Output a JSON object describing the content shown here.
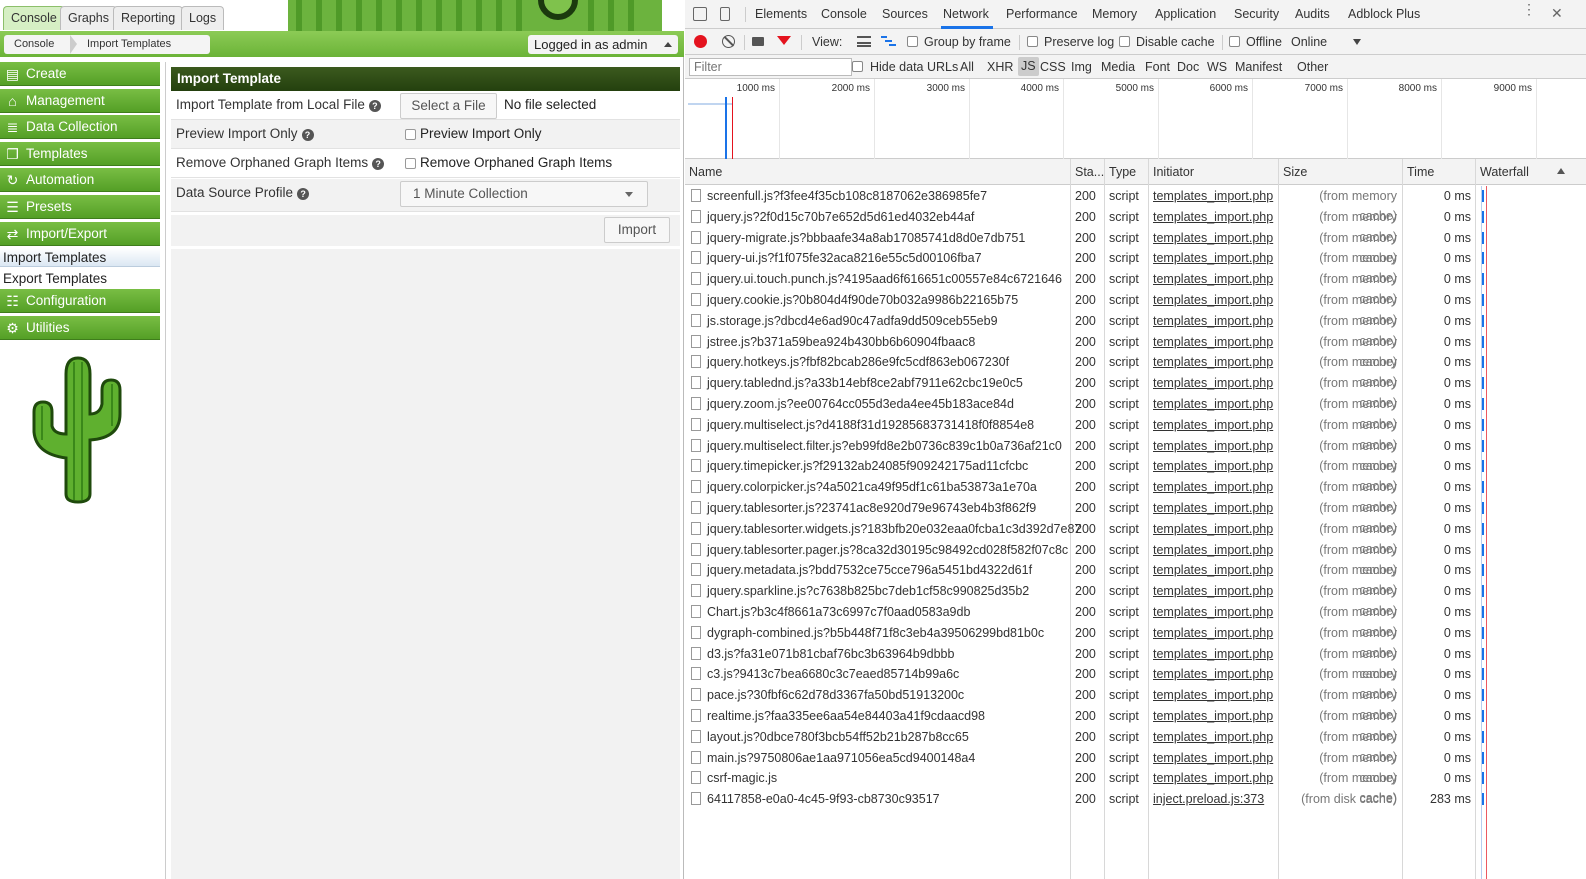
{
  "cacti": {
    "top_tabs": [
      "Console",
      "Graphs",
      "Reporting",
      "Logs"
    ],
    "breadcrumb": [
      "Console",
      "Import Templates"
    ],
    "login_text": "Logged in as admin",
    "menu": {
      "create": "Create",
      "management": "Management",
      "data_collection": "Data Collection",
      "templates": "Templates",
      "automation": "Automation",
      "presets": "Presets",
      "import_export": "Import/Export",
      "import_templates": "Import Templates",
      "export_templates": "Export Templates",
      "configuration": "Configuration",
      "utilities": "Utilities"
    },
    "form": {
      "title": "Import Template",
      "file_label": "Import Template from Local File",
      "file_button": "Select a File",
      "file_status": "No file selected",
      "preview_label": "Preview Import Only",
      "preview_checkbox": "Preview Import Only",
      "orphan_label": "Remove Orphaned Graph Items",
      "orphan_checkbox": "Remove Orphaned Graph Items",
      "profile_label": "Data Source Profile",
      "profile_value": "1 Minute Collection",
      "import_button": "Import"
    },
    "colors": {
      "menu_green": "#549f26",
      "header_dark": "#24400e"
    }
  },
  "devtools": {
    "tabs": [
      "Elements",
      "Console",
      "Sources",
      "Network",
      "Performance",
      "Memory",
      "Application",
      "Security",
      "Audits",
      "Adblock Plus"
    ],
    "active_tab": "Network",
    "toolbar": {
      "view_label": "View:",
      "group_by_frame": "Group by frame",
      "preserve_log": "Preserve log",
      "disable_cache": "Disable cache",
      "offline": "Offline",
      "throttle": "Online"
    },
    "filter_placeholder": "Filter",
    "hide_data_urls": "Hide data URLs",
    "filter_types": [
      "All",
      "XHR",
      "JS",
      "CSS",
      "Img",
      "Media",
      "Font",
      "Doc",
      "WS",
      "Manifest",
      "Other"
    ],
    "active_filter": "JS",
    "timeline_labels": [
      "1000 ms",
      "2000 ms",
      "3000 ms",
      "4000 ms",
      "5000 ms",
      "6000 ms",
      "7000 ms",
      "8000 ms",
      "9000 ms"
    ],
    "columns": {
      "name": "Name",
      "status": "Sta...",
      "type": "Type",
      "initiator": "Initiator",
      "size": "Size",
      "time": "Time",
      "waterfall": "Waterfall"
    },
    "rows": [
      {
        "name": "screenfull.js?f3fee4f35cb108c8187062e386985fe7",
        "status": "200",
        "type": "script",
        "initiator": "templates_import.php",
        "size": "(from memory cache)",
        "time": "0 ms"
      },
      {
        "name": "jquery.js?2f0d15c70b7e652d5d61ed4032eb44af",
        "status": "200",
        "type": "script",
        "initiator": "templates_import.php",
        "size": "(from memory cache)",
        "time": "0 ms"
      },
      {
        "name": "jquery-migrate.js?bbbaafe34a8ab17085741d8d0e7db751",
        "status": "200",
        "type": "script",
        "initiator": "templates_import.php",
        "size": "(from memory cache)",
        "time": "0 ms"
      },
      {
        "name": "jquery-ui.js?f1f075fe32aca8216e55c5d00106fba7",
        "status": "200",
        "type": "script",
        "initiator": "templates_import.php",
        "size": "(from memory cache)",
        "time": "0 ms"
      },
      {
        "name": "jquery.ui.touch.punch.js?4195aad6f616651c00557e84c6721646",
        "status": "200",
        "type": "script",
        "initiator": "templates_import.php",
        "size": "(from memory cache)",
        "time": "0 ms"
      },
      {
        "name": "jquery.cookie.js?0b804d4f90de70b032a9986b22165b75",
        "status": "200",
        "type": "script",
        "initiator": "templates_import.php",
        "size": "(from memory cache)",
        "time": "0 ms"
      },
      {
        "name": "js.storage.js?dbcd4e6ad90c47adfa9dd509ceb55eb9",
        "status": "200",
        "type": "script",
        "initiator": "templates_import.php",
        "size": "(from memory cache)",
        "time": "0 ms"
      },
      {
        "name": "jstree.js?b371a59bea924b430bb6b60904fbaac8",
        "status": "200",
        "type": "script",
        "initiator": "templates_import.php",
        "size": "(from memory cache)",
        "time": "0 ms"
      },
      {
        "name": "jquery.hotkeys.js?fbf82bcab286e9fc5cdf863eb067230f",
        "status": "200",
        "type": "script",
        "initiator": "templates_import.php",
        "size": "(from memory cache)",
        "time": "0 ms"
      },
      {
        "name": "jquery.tablednd.js?a33b14ebf8ce2abf7911e62cbc19e0c5",
        "status": "200",
        "type": "script",
        "initiator": "templates_import.php",
        "size": "(from memory cache)",
        "time": "0 ms"
      },
      {
        "name": "jquery.zoom.js?ee00764cc055d3eda4ee45b183ace84d",
        "status": "200",
        "type": "script",
        "initiator": "templates_import.php",
        "size": "(from memory cache)",
        "time": "0 ms"
      },
      {
        "name": "jquery.multiselect.js?d4188f31d19285683731418f0f8854e8",
        "status": "200",
        "type": "script",
        "initiator": "templates_import.php",
        "size": "(from memory cache)",
        "time": "0 ms"
      },
      {
        "name": "jquery.multiselect.filter.js?eb99fd8e2b0736c839c1b0a736af21c0",
        "status": "200",
        "type": "script",
        "initiator": "templates_import.php",
        "size": "(from memory cache)",
        "time": "0 ms"
      },
      {
        "name": "jquery.timepicker.js?f29132ab24085f909242175ad11cfcbc",
        "status": "200",
        "type": "script",
        "initiator": "templates_import.php",
        "size": "(from memory cache)",
        "time": "0 ms"
      },
      {
        "name": "jquery.colorpicker.js?4a5021ca49f95df1c61ba53873a1e70a",
        "status": "200",
        "type": "script",
        "initiator": "templates_import.php",
        "size": "(from memory cache)",
        "time": "0 ms"
      },
      {
        "name": "jquery.tablesorter.js?23741ac8e920d79e96743eb4b3f862f9",
        "status": "200",
        "type": "script",
        "initiator": "templates_import.php",
        "size": "(from memory cache)",
        "time": "0 ms"
      },
      {
        "name": "jquery.tablesorter.widgets.js?183bfb20e032eaa0fcba1c3d392d7e87",
        "status": "200",
        "type": "script",
        "initiator": "templates_import.php",
        "size": "(from memory cache)",
        "time": "0 ms"
      },
      {
        "name": "jquery.tablesorter.pager.js?8ca32d30195c98492cd028f582f07c8c",
        "status": "200",
        "type": "script",
        "initiator": "templates_import.php",
        "size": "(from memory cache)",
        "time": "0 ms"
      },
      {
        "name": "jquery.metadata.js?bdd7532ce75cce796a5451bd4322d61f",
        "status": "200",
        "type": "script",
        "initiator": "templates_import.php",
        "size": "(from memory cache)",
        "time": "0 ms"
      },
      {
        "name": "jquery.sparkline.js?c7638b825bc7deb1cf58c990825d35b2",
        "status": "200",
        "type": "script",
        "initiator": "templates_import.php",
        "size": "(from memory cache)",
        "time": "0 ms"
      },
      {
        "name": "Chart.js?b3c4f8661a73c6997c7f0aad0583a9db",
        "status": "200",
        "type": "script",
        "initiator": "templates_import.php",
        "size": "(from memory cache)",
        "time": "0 ms"
      },
      {
        "name": "dygraph-combined.js?b5b448f71f8c3eb4a39506299bd81b0c",
        "status": "200",
        "type": "script",
        "initiator": "templates_import.php",
        "size": "(from memory cache)",
        "time": "0 ms"
      },
      {
        "name": "d3.js?fa31e071b81cbaf76bc3b63964b9dbbb",
        "status": "200",
        "type": "script",
        "initiator": "templates_import.php",
        "size": "(from memory cache)",
        "time": "0 ms"
      },
      {
        "name": "c3.js?9413c7bea6680c3c7eaed85714b99a6c",
        "status": "200",
        "type": "script",
        "initiator": "templates_import.php",
        "size": "(from memory cache)",
        "time": "0 ms"
      },
      {
        "name": "pace.js?30fbf6c62d78d3367fa50bd51913200c",
        "status": "200",
        "type": "script",
        "initiator": "templates_import.php",
        "size": "(from memory cache)",
        "time": "0 ms"
      },
      {
        "name": "realtime.js?faa335ee6aa54e84403a41f9cdaacd98",
        "status": "200",
        "type": "script",
        "initiator": "templates_import.php",
        "size": "(from memory cache)",
        "time": "0 ms"
      },
      {
        "name": "layout.js?0dbce780f3bcb54ff52b21b287b8cc65",
        "status": "200",
        "type": "script",
        "initiator": "templates_import.php",
        "size": "(from memory cache)",
        "time": "0 ms"
      },
      {
        "name": "main.js?9750806ae1aa971056ea5cd9400148a4",
        "status": "200",
        "type": "script",
        "initiator": "templates_import.php",
        "size": "(from memory cache)",
        "time": "0 ms"
      },
      {
        "name": "csrf-magic.js",
        "status": "200",
        "type": "script",
        "initiator": "templates_import.php",
        "size": "(from memory cache)",
        "time": "0 ms"
      },
      {
        "name": "64117858-e0a0-4c45-9f93-cb8730c93517",
        "status": "200",
        "type": "script",
        "initiator": "inject.preload.js:373",
        "size": "(from disk cache)",
        "time": "283 ms"
      }
    ]
  }
}
